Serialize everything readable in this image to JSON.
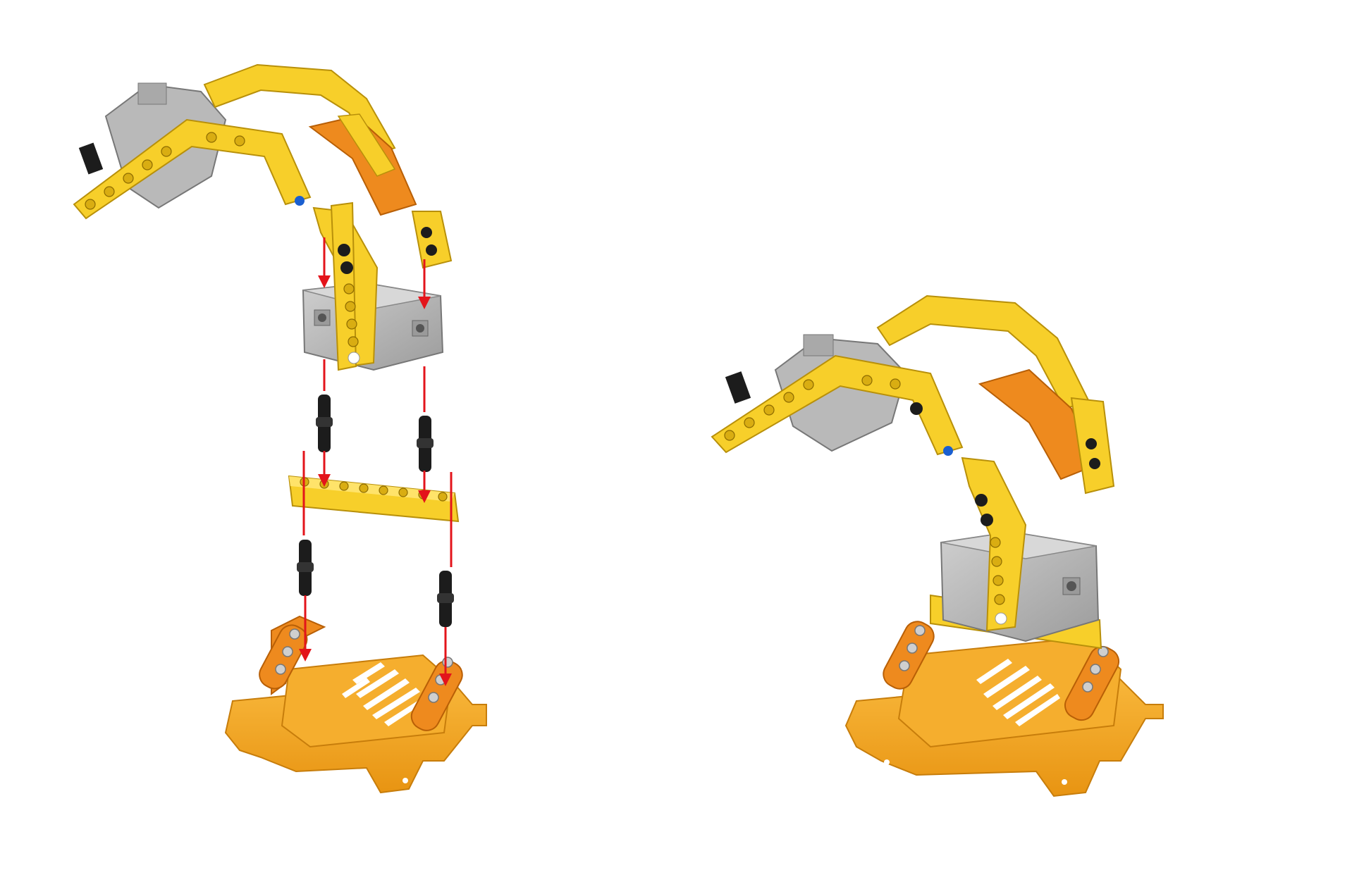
{
  "figure": {
    "panels": [
      {
        "id": "exploded-step",
        "description_visible": false
      },
      {
        "id": "assembled-result",
        "description_visible": false
      }
    ],
    "colors": {
      "background": "#ffffff",
      "beam_yellow": "#f7cf2a",
      "beam_yellow_dark": "#d9ad12",
      "beam_edge": "#b8900a",
      "servo_gray": "#b9b9b9",
      "servo_gray_dark": "#8f8f8f",
      "orange_plate": "#f2a422",
      "orange_plate_dark": "#d58412",
      "orange_beam": "#ee8a1e",
      "pin_black": "#1c1c1c",
      "arrow_red": "#e3141b",
      "hole_dark": "#222222",
      "axle_blue": "#1a5fd0"
    }
  }
}
